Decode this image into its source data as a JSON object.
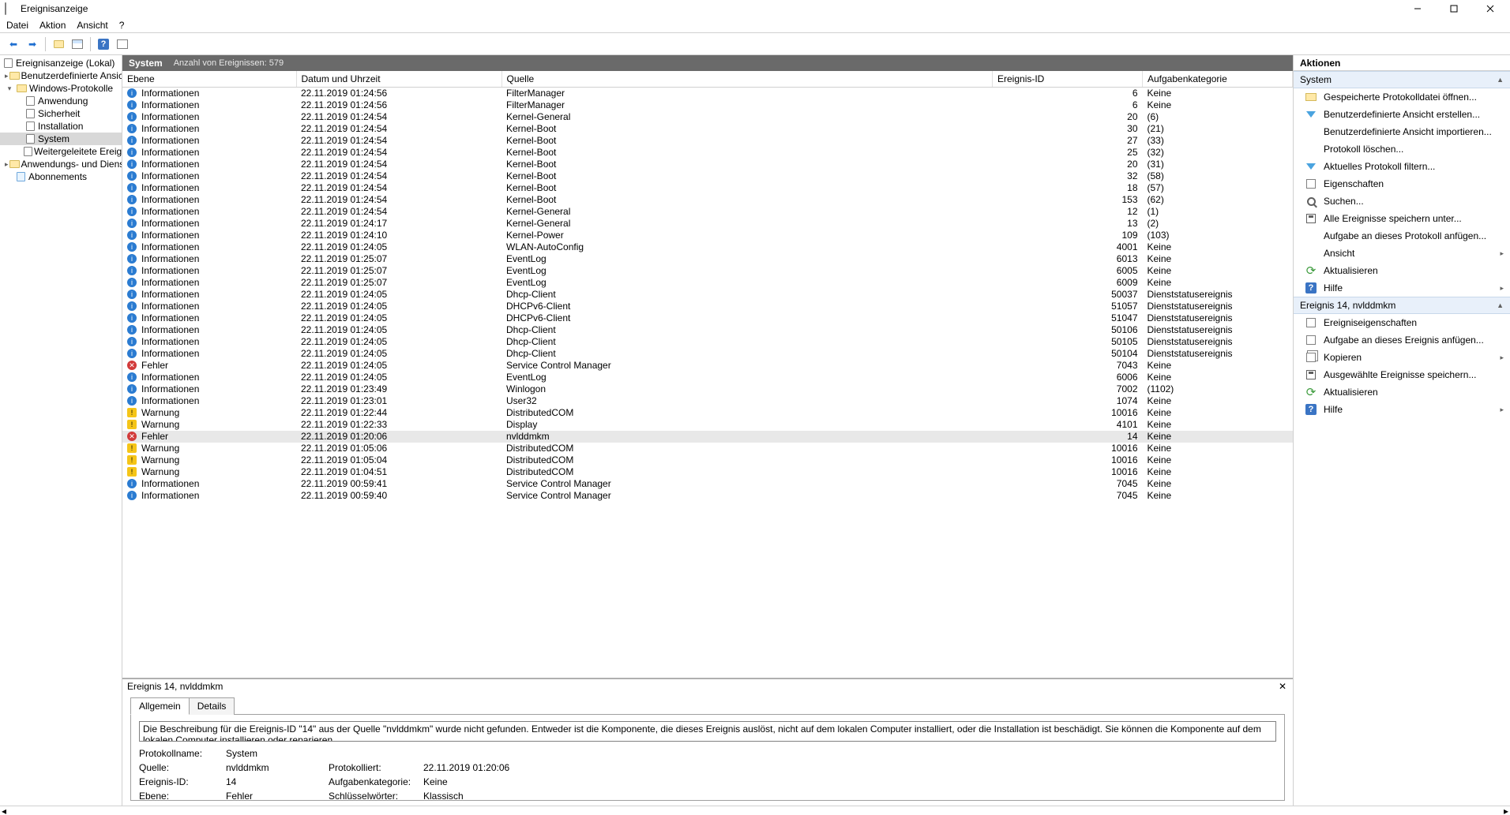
{
  "window": {
    "title": "Ereignisanzeige"
  },
  "menu": {
    "file": "Datei",
    "action": "Aktion",
    "view": "Ansicht",
    "help": "?"
  },
  "tree": {
    "root": "Ereignisanzeige (Lokal)",
    "customViews": "Benutzerdefinierte Ansichten",
    "winLogs": "Windows-Protokolle",
    "app": "Anwendung",
    "security": "Sicherheit",
    "setup": "Installation",
    "system": "System",
    "forwarded": "Weitergeleitete Ereignisse",
    "appsServices": "Anwendungs- und Dienstprotokolle",
    "subscriptions": "Abonnements"
  },
  "centerHeader": {
    "name": "System",
    "count": "Anzahl von Ereignissen: 579"
  },
  "columns": {
    "level": "Ebene",
    "date": "Datum und Uhrzeit",
    "source": "Quelle",
    "id": "Ereignis-ID",
    "cat": "Aufgabenkategorie"
  },
  "levelLabels": {
    "info": "Informationen",
    "warn": "Warnung",
    "error": "Fehler"
  },
  "events": [
    {
      "level": "info",
      "date": "22.11.2019 01:24:56",
      "src": "FilterManager",
      "id": 6,
      "cat": "Keine"
    },
    {
      "level": "info",
      "date": "22.11.2019 01:24:56",
      "src": "FilterManager",
      "id": 6,
      "cat": "Keine"
    },
    {
      "level": "info",
      "date": "22.11.2019 01:24:54",
      "src": "Kernel-General",
      "id": 20,
      "cat": "(6)"
    },
    {
      "level": "info",
      "date": "22.11.2019 01:24:54",
      "src": "Kernel-Boot",
      "id": 30,
      "cat": "(21)"
    },
    {
      "level": "info",
      "date": "22.11.2019 01:24:54",
      "src": "Kernel-Boot",
      "id": 27,
      "cat": "(33)"
    },
    {
      "level": "info",
      "date": "22.11.2019 01:24:54",
      "src": "Kernel-Boot",
      "id": 25,
      "cat": "(32)"
    },
    {
      "level": "info",
      "date": "22.11.2019 01:24:54",
      "src": "Kernel-Boot",
      "id": 20,
      "cat": "(31)"
    },
    {
      "level": "info",
      "date": "22.11.2019 01:24:54",
      "src": "Kernel-Boot",
      "id": 32,
      "cat": "(58)"
    },
    {
      "level": "info",
      "date": "22.11.2019 01:24:54",
      "src": "Kernel-Boot",
      "id": 18,
      "cat": "(57)"
    },
    {
      "level": "info",
      "date": "22.11.2019 01:24:54",
      "src": "Kernel-Boot",
      "id": 153,
      "cat": "(62)"
    },
    {
      "level": "info",
      "date": "22.11.2019 01:24:54",
      "src": "Kernel-General",
      "id": 12,
      "cat": "(1)"
    },
    {
      "level": "info",
      "date": "22.11.2019 01:24:17",
      "src": "Kernel-General",
      "id": 13,
      "cat": "(2)"
    },
    {
      "level": "info",
      "date": "22.11.2019 01:24:10",
      "src": "Kernel-Power",
      "id": 109,
      "cat": "(103)"
    },
    {
      "level": "info",
      "date": "22.11.2019 01:24:05",
      "src": "WLAN-AutoConfig",
      "id": 4001,
      "cat": "Keine"
    },
    {
      "level": "info",
      "date": "22.11.2019 01:25:07",
      "src": "EventLog",
      "id": 6013,
      "cat": "Keine"
    },
    {
      "level": "info",
      "date": "22.11.2019 01:25:07",
      "src": "EventLog",
      "id": 6005,
      "cat": "Keine"
    },
    {
      "level": "info",
      "date": "22.11.2019 01:25:07",
      "src": "EventLog",
      "id": 6009,
      "cat": "Keine"
    },
    {
      "level": "info",
      "date": "22.11.2019 01:24:05",
      "src": "Dhcp-Client",
      "id": 50037,
      "cat": "Dienststatusereignis"
    },
    {
      "level": "info",
      "date": "22.11.2019 01:24:05",
      "src": "DHCPv6-Client",
      "id": 51057,
      "cat": "Dienststatusereignis"
    },
    {
      "level": "info",
      "date": "22.11.2019 01:24:05",
      "src": "DHCPv6-Client",
      "id": 51047,
      "cat": "Dienststatusereignis"
    },
    {
      "level": "info",
      "date": "22.11.2019 01:24:05",
      "src": "Dhcp-Client",
      "id": 50106,
      "cat": "Dienststatusereignis"
    },
    {
      "level": "info",
      "date": "22.11.2019 01:24:05",
      "src": "Dhcp-Client",
      "id": 50105,
      "cat": "Dienststatusereignis"
    },
    {
      "level": "info",
      "date": "22.11.2019 01:24:05",
      "src": "Dhcp-Client",
      "id": 50104,
      "cat": "Dienststatusereignis"
    },
    {
      "level": "error",
      "date": "22.11.2019 01:24:05",
      "src": "Service Control Manager",
      "id": 7043,
      "cat": "Keine"
    },
    {
      "level": "info",
      "date": "22.11.2019 01:24:05",
      "src": "EventLog",
      "id": 6006,
      "cat": "Keine"
    },
    {
      "level": "info",
      "date": "22.11.2019 01:23:49",
      "src": "Winlogon",
      "id": 7002,
      "cat": "(1102)"
    },
    {
      "level": "info",
      "date": "22.11.2019 01:23:01",
      "src": "User32",
      "id": 1074,
      "cat": "Keine"
    },
    {
      "level": "warn",
      "date": "22.11.2019 01:22:44",
      "src": "DistributedCOM",
      "id": 10016,
      "cat": "Keine"
    },
    {
      "level": "warn",
      "date": "22.11.2019 01:22:33",
      "src": "Display",
      "id": 4101,
      "cat": "Keine"
    },
    {
      "level": "error",
      "date": "22.11.2019 01:20:06",
      "src": "nvlddmkm",
      "id": 14,
      "cat": "Keine",
      "selected": true
    },
    {
      "level": "warn",
      "date": "22.11.2019 01:05:06",
      "src": "DistributedCOM",
      "id": 10016,
      "cat": "Keine"
    },
    {
      "level": "warn",
      "date": "22.11.2019 01:05:04",
      "src": "DistributedCOM",
      "id": 10016,
      "cat": "Keine"
    },
    {
      "level": "warn",
      "date": "22.11.2019 01:04:51",
      "src": "DistributedCOM",
      "id": 10016,
      "cat": "Keine"
    },
    {
      "level": "info",
      "date": "22.11.2019 00:59:41",
      "src": "Service Control Manager",
      "id": 7045,
      "cat": "Keine"
    },
    {
      "level": "info",
      "date": "22.11.2019 00:59:40",
      "src": "Service Control Manager",
      "id": 7045,
      "cat": "Keine"
    }
  ],
  "details": {
    "header": "Ereignis 14, nvlddmkm",
    "tabs": {
      "general": "Allgemein",
      "details": "Details"
    },
    "description": "Die Beschreibung für die Ereignis-ID \"14\" aus der Quelle \"nvlddmkm\" wurde nicht gefunden. Entweder ist die Komponente, die dieses Ereignis auslöst, nicht auf dem lokalen Computer installiert, oder die Installation ist beschädigt. Sie können die Komponente auf dem lokalen Computer installieren oder reparieren.",
    "labels": {
      "logName": "Protokollname:",
      "source": "Quelle:",
      "eventId": "Ereignis-ID:",
      "level": "Ebene:",
      "logged": "Protokolliert:",
      "taskCat": "Aufgabenkategorie:",
      "keywords": "Schlüsselwörter:"
    },
    "values": {
      "logName": "System",
      "source": "nvlddmkm",
      "eventId": "14",
      "level": "Fehler",
      "logged": "22.11.2019 01:20:06",
      "taskCat": "Keine",
      "keywords": "Klassisch"
    }
  },
  "actions": {
    "title": "Aktionen",
    "group1": "System",
    "group2": "Ereignis 14, nvlddmkm",
    "items1": {
      "openSaved": "Gespeicherte Protokolldatei öffnen...",
      "createView": "Benutzerdefinierte Ansicht erstellen...",
      "importView": "Benutzerdefinierte Ansicht importieren...",
      "clearLog": "Protokoll löschen...",
      "filterLog": "Aktuelles Protokoll filtern...",
      "properties": "Eigenschaften",
      "find": "Suchen...",
      "saveAll": "Alle Ereignisse speichern unter...",
      "attachTask": "Aufgabe an dieses Protokoll anfügen...",
      "view": "Ansicht",
      "refresh": "Aktualisieren",
      "help": "Hilfe"
    },
    "items2": {
      "eventProps": "Ereigniseigenschaften",
      "attachEvent": "Aufgabe an dieses Ereignis anfügen...",
      "copy": "Kopieren",
      "saveSelected": "Ausgewählte Ereignisse speichern...",
      "refresh": "Aktualisieren",
      "help": "Hilfe"
    }
  }
}
